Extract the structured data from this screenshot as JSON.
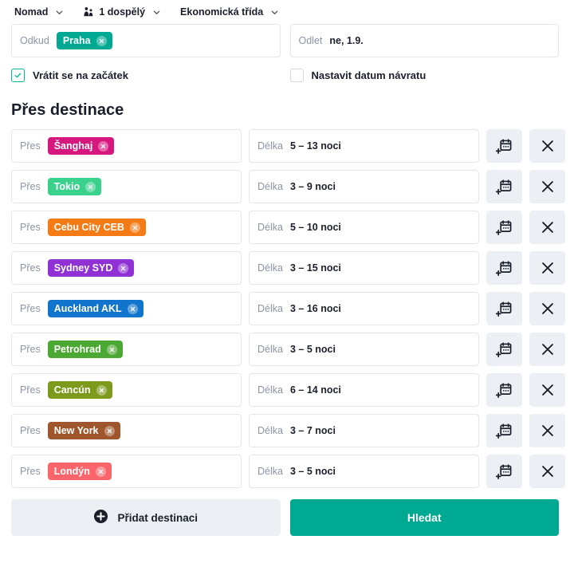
{
  "topbar": {
    "items": [
      {
        "label": "Nomad",
        "icon": null,
        "chevron": true
      },
      {
        "label": "1 dospělý",
        "icon": "passengers-icon",
        "chevron": true
      },
      {
        "label": "Ekonomická třída",
        "icon": null,
        "chevron": true
      }
    ]
  },
  "search": {
    "origin": {
      "label": "Odkud",
      "chip": {
        "text": "Praha",
        "color": "#00a991"
      }
    },
    "departure": {
      "label": "Odlet",
      "value": "ne, 1.9."
    },
    "return_to_start": {
      "label": "Vrátit se na začátek",
      "checked": true
    },
    "set_return_date": {
      "label": "Nastavit datum návratu",
      "checked": false
    }
  },
  "section": {
    "title": "Přes destinace",
    "dest_label": "Přes",
    "length_label": "Délka",
    "rows": [
      {
        "chip": {
          "text": "Šanghaj",
          "color": "#d6177e"
        },
        "length": "5 – 13 noci"
      },
      {
        "chip": {
          "text": "Tokio",
          "color": "#3ad18c"
        },
        "length": "3 – 9 noci"
      },
      {
        "chip": {
          "text": "Cebu City CEB",
          "color": "#f47b16"
        },
        "length": "5 – 10 noci"
      },
      {
        "chip": {
          "text": "Sydney SYD",
          "color": "#9031d6"
        },
        "length": "3 – 15 noci"
      },
      {
        "chip": {
          "text": "Auckland AKL",
          "color": "#1175cd"
        },
        "length": "3 – 16 noci"
      },
      {
        "chip": {
          "text": "Petrohrad",
          "color": "#4ba832"
        },
        "length": "3 – 5 noci"
      },
      {
        "chip": {
          "text": "Cancún",
          "color": "#7d9a1c"
        },
        "length": "6 – 14 noci"
      },
      {
        "chip": {
          "text": "New York",
          "color": "#a0562c"
        },
        "length": "3 – 7 noci"
      },
      {
        "chip": {
          "text": "Londýn",
          "color": "#f9656a"
        },
        "length": "3 – 5 noci"
      }
    ],
    "row_calendar_icon": "calendar-plus-icon",
    "row_remove_icon": "close-icon"
  },
  "footer": {
    "add_label": "Přidat destinaci",
    "add_icon": "plus-circle-icon",
    "search_label": "Hledat",
    "search_color": "#00a991"
  }
}
